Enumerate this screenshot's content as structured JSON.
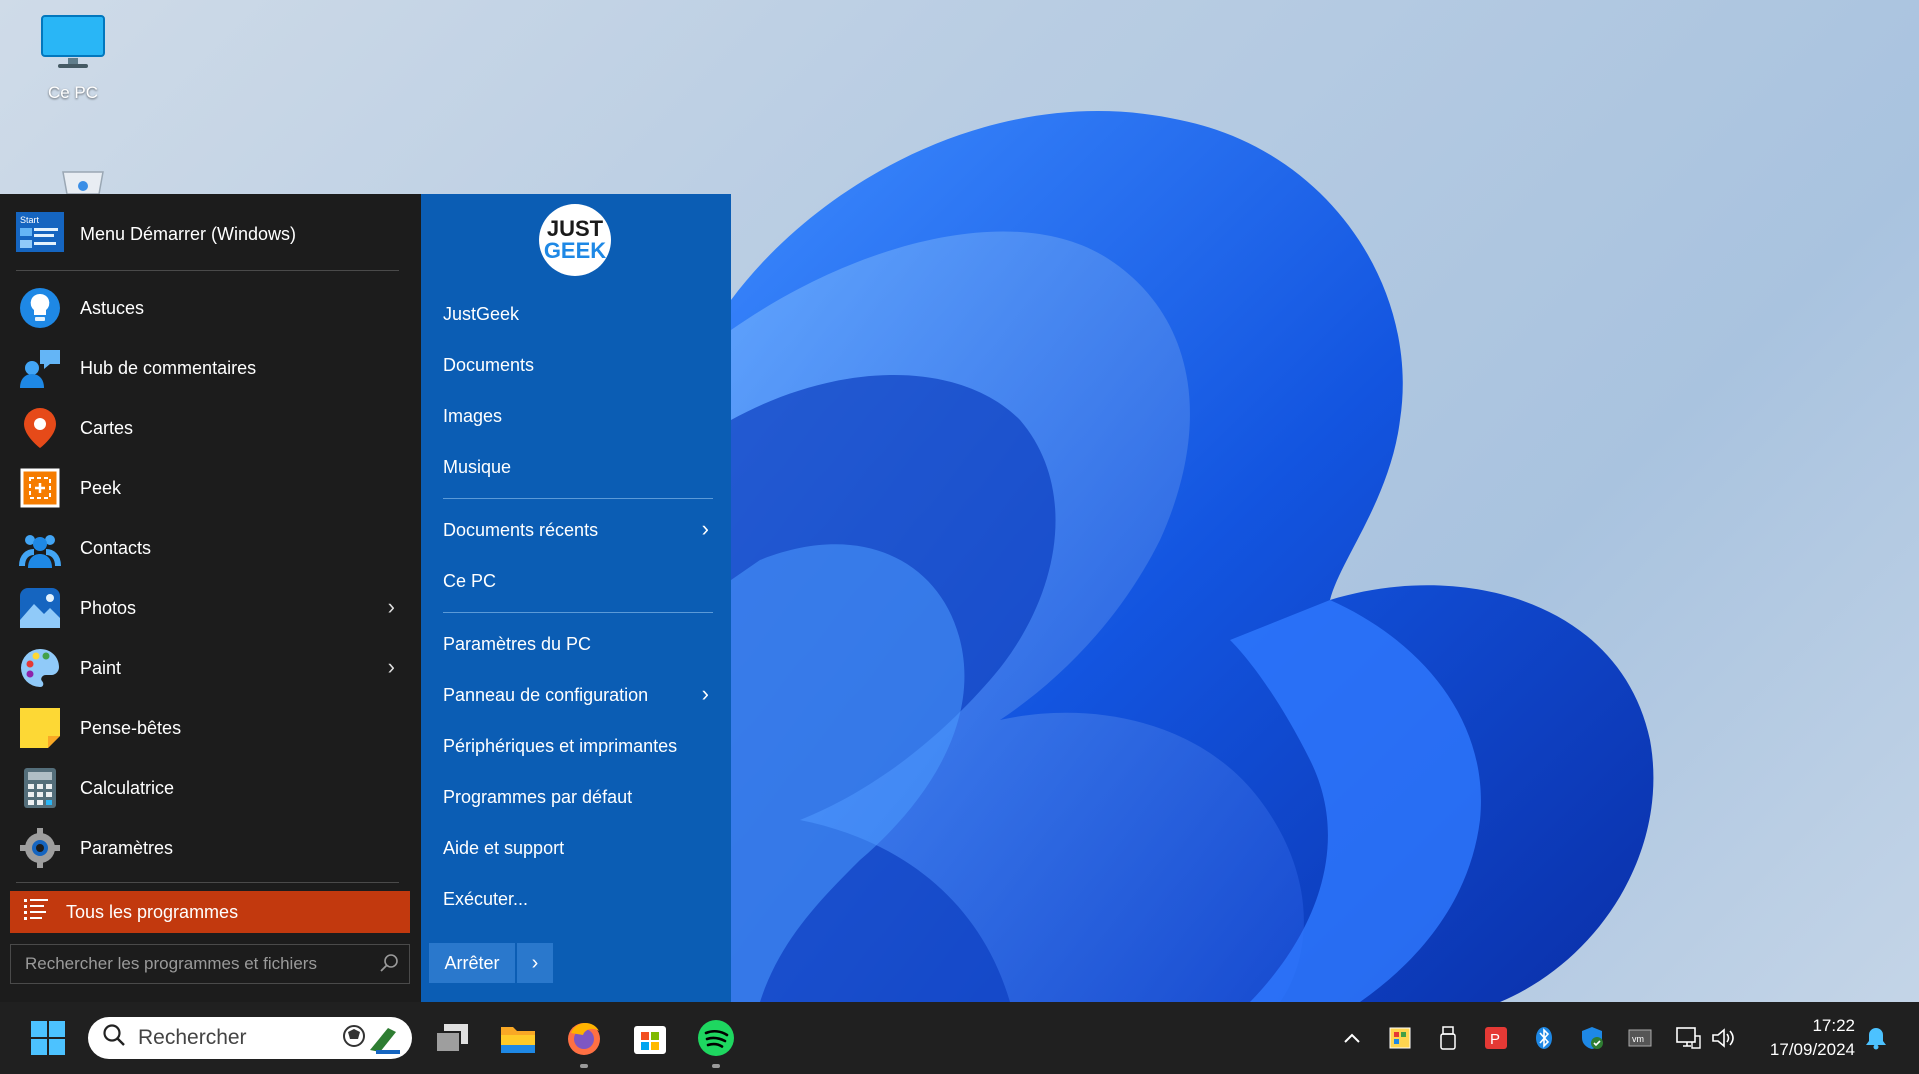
{
  "desktop": {
    "icons": [
      {
        "label": "Ce PC",
        "icon": "monitor-icon"
      },
      {
        "label": "",
        "icon": "recycle-bin-icon"
      }
    ]
  },
  "start_menu": {
    "header": {
      "label": "Menu Démarrer (Windows)",
      "icon": "start-menu-app-icon"
    },
    "apps": [
      {
        "label": "Astuces",
        "icon": "lightbulb-icon",
        "has_submenu": false
      },
      {
        "label": "Hub de commentaires",
        "icon": "feedback-hub-icon",
        "has_submenu": false
      },
      {
        "label": "Cartes",
        "icon": "maps-pin-icon",
        "has_submenu": false
      },
      {
        "label": "Peek",
        "icon": "peek-icon",
        "has_submenu": false
      },
      {
        "label": "Contacts",
        "icon": "contacts-icon",
        "has_submenu": false
      },
      {
        "label": "Photos",
        "icon": "photos-icon",
        "has_submenu": true
      },
      {
        "label": "Paint",
        "icon": "paint-palette-icon",
        "has_submenu": true
      },
      {
        "label": "Pense-bêtes",
        "icon": "sticky-notes-icon",
        "has_submenu": false
      },
      {
        "label": "Calculatrice",
        "icon": "calculator-icon",
        "has_submenu": false
      },
      {
        "label": "Paramètres",
        "icon": "settings-gear-icon",
        "has_submenu": false
      }
    ],
    "all_programs": "Tous les programmes",
    "search_placeholder": "Rechercher les programmes et fichiers",
    "right": {
      "logo_line1": "JUST",
      "logo_line2": "GEEK",
      "group1": [
        "JustGeek",
        "Documents",
        "Images",
        "Musique"
      ],
      "group2": [
        {
          "label": "Documents récents",
          "has_submenu": true
        },
        {
          "label": "Ce PC",
          "has_submenu": false
        }
      ],
      "group3": [
        {
          "label": "Paramètres du PC",
          "has_submenu": false
        },
        {
          "label": "Panneau de configuration",
          "has_submenu": true
        },
        {
          "label": "Périphériques et imprimantes",
          "has_submenu": false
        },
        {
          "label": "Programmes par défaut",
          "has_submenu": false
        },
        {
          "label": "Aide et support",
          "has_submenu": false
        },
        {
          "label": "Exécuter...",
          "has_submenu": false
        }
      ],
      "shutdown_label": "Arrêter"
    }
  },
  "taskbar": {
    "search_placeholder": "Rechercher",
    "apps": [
      "windows-start-icon",
      "task-view-icon",
      "file-explorer-icon",
      "firefox-icon",
      "microsoft-store-icon",
      "spotify-icon"
    ],
    "tray": [
      "chevron-up-icon",
      "color-picker-icon",
      "usb-drive-icon",
      "screenshot-tool-icon",
      "bluetooth-icon",
      "security-shield-icon",
      "vmware-icon",
      "network-icon",
      "volume-icon"
    ],
    "time": "17:22",
    "date": "17/09/2024"
  },
  "colors": {
    "start_left_bg": "#1c1c1c",
    "start_right_bg": "#0b5db4",
    "all_programs_bg": "#c2390e",
    "taskbar_bg": "#202020"
  }
}
